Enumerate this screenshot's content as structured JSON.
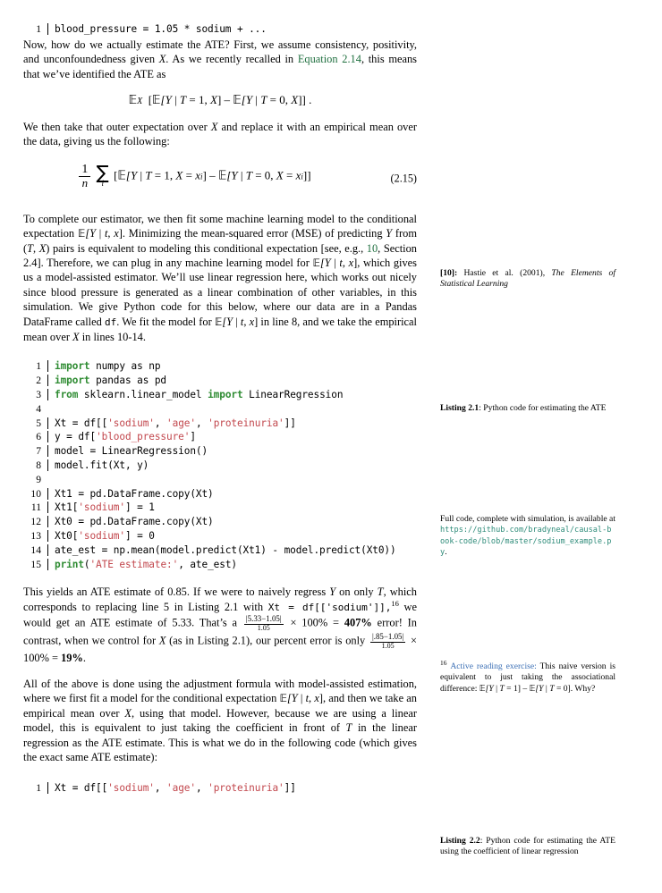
{
  "top_code": {
    "lines": [
      {
        "num": "1",
        "code": "blood_pressure = 1.05 * sodium + ..."
      }
    ]
  },
  "paragraphs": {
    "p1_a": "Now, how do we actually estimate the ATE? First, we assume consistency, positivity, and unconfoundedness given ",
    "p1_x": "X",
    "p1_b": ". As we recently recalled in ",
    "p1_eqref": "Equation 2.14",
    "p1_c": ", this means that we’ve identified the ATE as",
    "p2": "We then take that outer expectation over X and replace it with an empirical mean over the data, giving us the following:",
    "p2_a": "We then take that outer expectation over ",
    "p2_x": "X",
    "p2_b": " and replace it with an empirical mean over the data, giving us the following:",
    "p3_s1": "To complete our estimator, we then fit some machine learning model to the conditional expectation ",
    "p3_s2": ". Minimizing the mean-squared error (MSE) of predicting ",
    "p3_s3": " from (",
    "p3_s4": ") pairs is equivalent to modeling this conditional expectation [see, e.g., ",
    "p3_cite": "10",
    "p3_s5": ", Section 2.4]. Therefore, we can plug in any machine learning model for ",
    "p3_s6": ", which gives us a model-assisted estimator. We’ll use linear regression here, which works out nicely since blood pressure is generated as a linear combination of other variables, in this simulation. We give Python code for this below, where our data are in a Pandas DataFrame called ",
    "p3_df": "df",
    "p3_s7": ". We fit the model for ",
    "p3_s8": " in line 8, and we take the empirical mean over ",
    "p3_s9": " in lines 10-14.",
    "p4_s1": "This yields an ATE estimate of 0.85. If we were to naively regress ",
    "p4_s2": " on only ",
    "p4_s3": ", which corresponds to replacing line 5 in Listing 2.1 with ",
    "p4_code": "Xt = df[['sodium']]",
    "p4_fnmark": "16",
    "p4_s4": " we would get an ATE estimate of 5.33. That’s a ",
    "p4_frac1_num": "|5.33−1.05|",
    "p4_frac1_den": "1.05",
    "p4_s5": " × 100% = ",
    "p4_pct1": "407%",
    "p4_s6": " error! In contrast, when we control for ",
    "p4_s7": " (as in Listing 2.1), our percent error is only ",
    "p4_frac2_num": "|.85−1.05|",
    "p4_frac2_den": "1.05",
    "p4_s8": " × 100% = ",
    "p4_pct2": "19%",
    "p4_s9": ".",
    "p5_s1": "All of the above is done using the adjustment formula with model-assisted estimation, where we first fit a model for the conditional expectation ",
    "p5_s2": ", and then we take an empirical mean over ",
    "p5_s3": ", using that model. However, because we are using a linear model, this is equivalent to just taking the coefficient in front of ",
    "p5_s4": " in the linear regression as the ATE estimate. This is what we do in the following code (which gives the exact same ATE estimate):"
  },
  "equations": {
    "eq1": "𝔼_X [𝔼[Y | T = 1, X] − 𝔼[Y | T = 0, X]] .",
    "eq1_E": "E",
    "eq1_sub": "X",
    "eq1_body": "[𝔼[Y | T = 1, X] − 𝔼[Y | T = 0, X]] .",
    "eq2_frac_num": "1",
    "eq2_frac_den": "n",
    "eq2_sum": "∑",
    "eq2_sum_sub": "i",
    "eq2_body": "[𝔼[Y | T = 1, X = xᵢ] − 𝔼[Y | T = 0, X = xᵢ]]",
    "eq2_tag": "(2.15)"
  },
  "listing_2_1": {
    "lines": [
      {
        "num": "1",
        "tokens": [
          {
            "t": "kw",
            "v": "import"
          },
          {
            "t": "p",
            "v": " numpy as np"
          }
        ]
      },
      {
        "num": "2",
        "tokens": [
          {
            "t": "kw",
            "v": "import"
          },
          {
            "t": "p",
            "v": " pandas as pd"
          }
        ]
      },
      {
        "num": "3",
        "tokens": [
          {
            "t": "kw",
            "v": "from"
          },
          {
            "t": "p",
            "v": " sklearn.linear_model "
          },
          {
            "t": "kw",
            "v": "import"
          },
          {
            "t": "p",
            "v": " LinearRegression"
          }
        ]
      },
      {
        "num": "4",
        "tokens": [
          {
            "t": "p",
            "v": ""
          }
        ]
      },
      {
        "num": "5",
        "tokens": [
          {
            "t": "p",
            "v": "Xt = df[["
          },
          {
            "t": "str",
            "v": "'sodium'"
          },
          {
            "t": "p",
            "v": ", "
          },
          {
            "t": "str",
            "v": "'age'"
          },
          {
            "t": "p",
            "v": ", "
          },
          {
            "t": "str",
            "v": "'proteinuria'"
          },
          {
            "t": "p",
            "v": "]]"
          }
        ]
      },
      {
        "num": "6",
        "tokens": [
          {
            "t": "p",
            "v": "y = df["
          },
          {
            "t": "str",
            "v": "'blood_pressure'"
          },
          {
            "t": "p",
            "v": "]"
          }
        ]
      },
      {
        "num": "7",
        "tokens": [
          {
            "t": "p",
            "v": "model = LinearRegression()"
          }
        ]
      },
      {
        "num": "8",
        "tokens": [
          {
            "t": "p",
            "v": "model.fit(Xt, y)"
          }
        ]
      },
      {
        "num": "9",
        "tokens": [
          {
            "t": "p",
            "v": ""
          }
        ]
      },
      {
        "num": "10",
        "tokens": [
          {
            "t": "p",
            "v": "Xt1 = pd.DataFrame.copy(Xt)"
          }
        ]
      },
      {
        "num": "11",
        "tokens": [
          {
            "t": "p",
            "v": "Xt1["
          },
          {
            "t": "str",
            "v": "'sodium'"
          },
          {
            "t": "p",
            "v": "] = 1"
          }
        ]
      },
      {
        "num": "12",
        "tokens": [
          {
            "t": "p",
            "v": "Xt0 = pd.DataFrame.copy(Xt)"
          }
        ]
      },
      {
        "num": "13",
        "tokens": [
          {
            "t": "p",
            "v": "Xt0["
          },
          {
            "t": "str",
            "v": "'sodium'"
          },
          {
            "t": "p",
            "v": "] = 0"
          }
        ]
      },
      {
        "num": "14",
        "tokens": [
          {
            "t": "p",
            "v": "ate_est = np.mean(model.predict(Xt1) - model.predict(Xt0))"
          }
        ]
      },
      {
        "num": "15",
        "tokens": [
          {
            "t": "fn",
            "v": "print"
          },
          {
            "t": "p",
            "v": "("
          },
          {
            "t": "str",
            "v": "'ATE estimate:'"
          },
          {
            "t": "p",
            "v": ", ate_est)"
          }
        ]
      }
    ]
  },
  "listing_2_2": {
    "lines": [
      {
        "num": "1",
        "tokens": [
          {
            "t": "p",
            "v": "Xt = df[["
          },
          {
            "t": "str",
            "v": "'sodium'"
          },
          {
            "t": "p",
            "v": ", "
          },
          {
            "t": "str",
            "v": "'age'"
          },
          {
            "t": "p",
            "v": ", "
          },
          {
            "t": "str",
            "v": "'proteinuria'"
          },
          {
            "t": "p",
            "v": "]]"
          }
        ]
      }
    ]
  },
  "margin_notes": {
    "citation_10": {
      "marker": "[10]: ",
      "authors": "Hastie et al. (2001), ",
      "title": "The Elements of Statistical Learning"
    },
    "listing_2_1_caption": {
      "label": "Listing 2.1",
      "text": ": Python code for estimating the ATE"
    },
    "full_code": {
      "text_before": "Full code, complete with simulation, is available at ",
      "url": "https://github.com/bradyneal/causal-book-code/blob/master/sodium_example.py",
      "text_after": "."
    },
    "footnote_16": {
      "marker": "16",
      "label": "Active reading exercise:",
      "text": " This naive version is equivalent to just taking the associational difference: ",
      "math": "𝔼[Y | T = 1] − 𝔼[Y | T = 0].",
      "tail": " Why?"
    },
    "listing_2_2_caption": {
      "label": "Listing 2.2",
      "text": ": Python code for estimating the ATE using the coefficient of linear regression"
    }
  },
  "colors": {
    "keyword_green": "#2f8c33",
    "string_red": "#c2474d",
    "url_teal": "#2f8c7a",
    "reference_green": "#1f6f3f",
    "exercise_blue": "#3b6fb5"
  }
}
